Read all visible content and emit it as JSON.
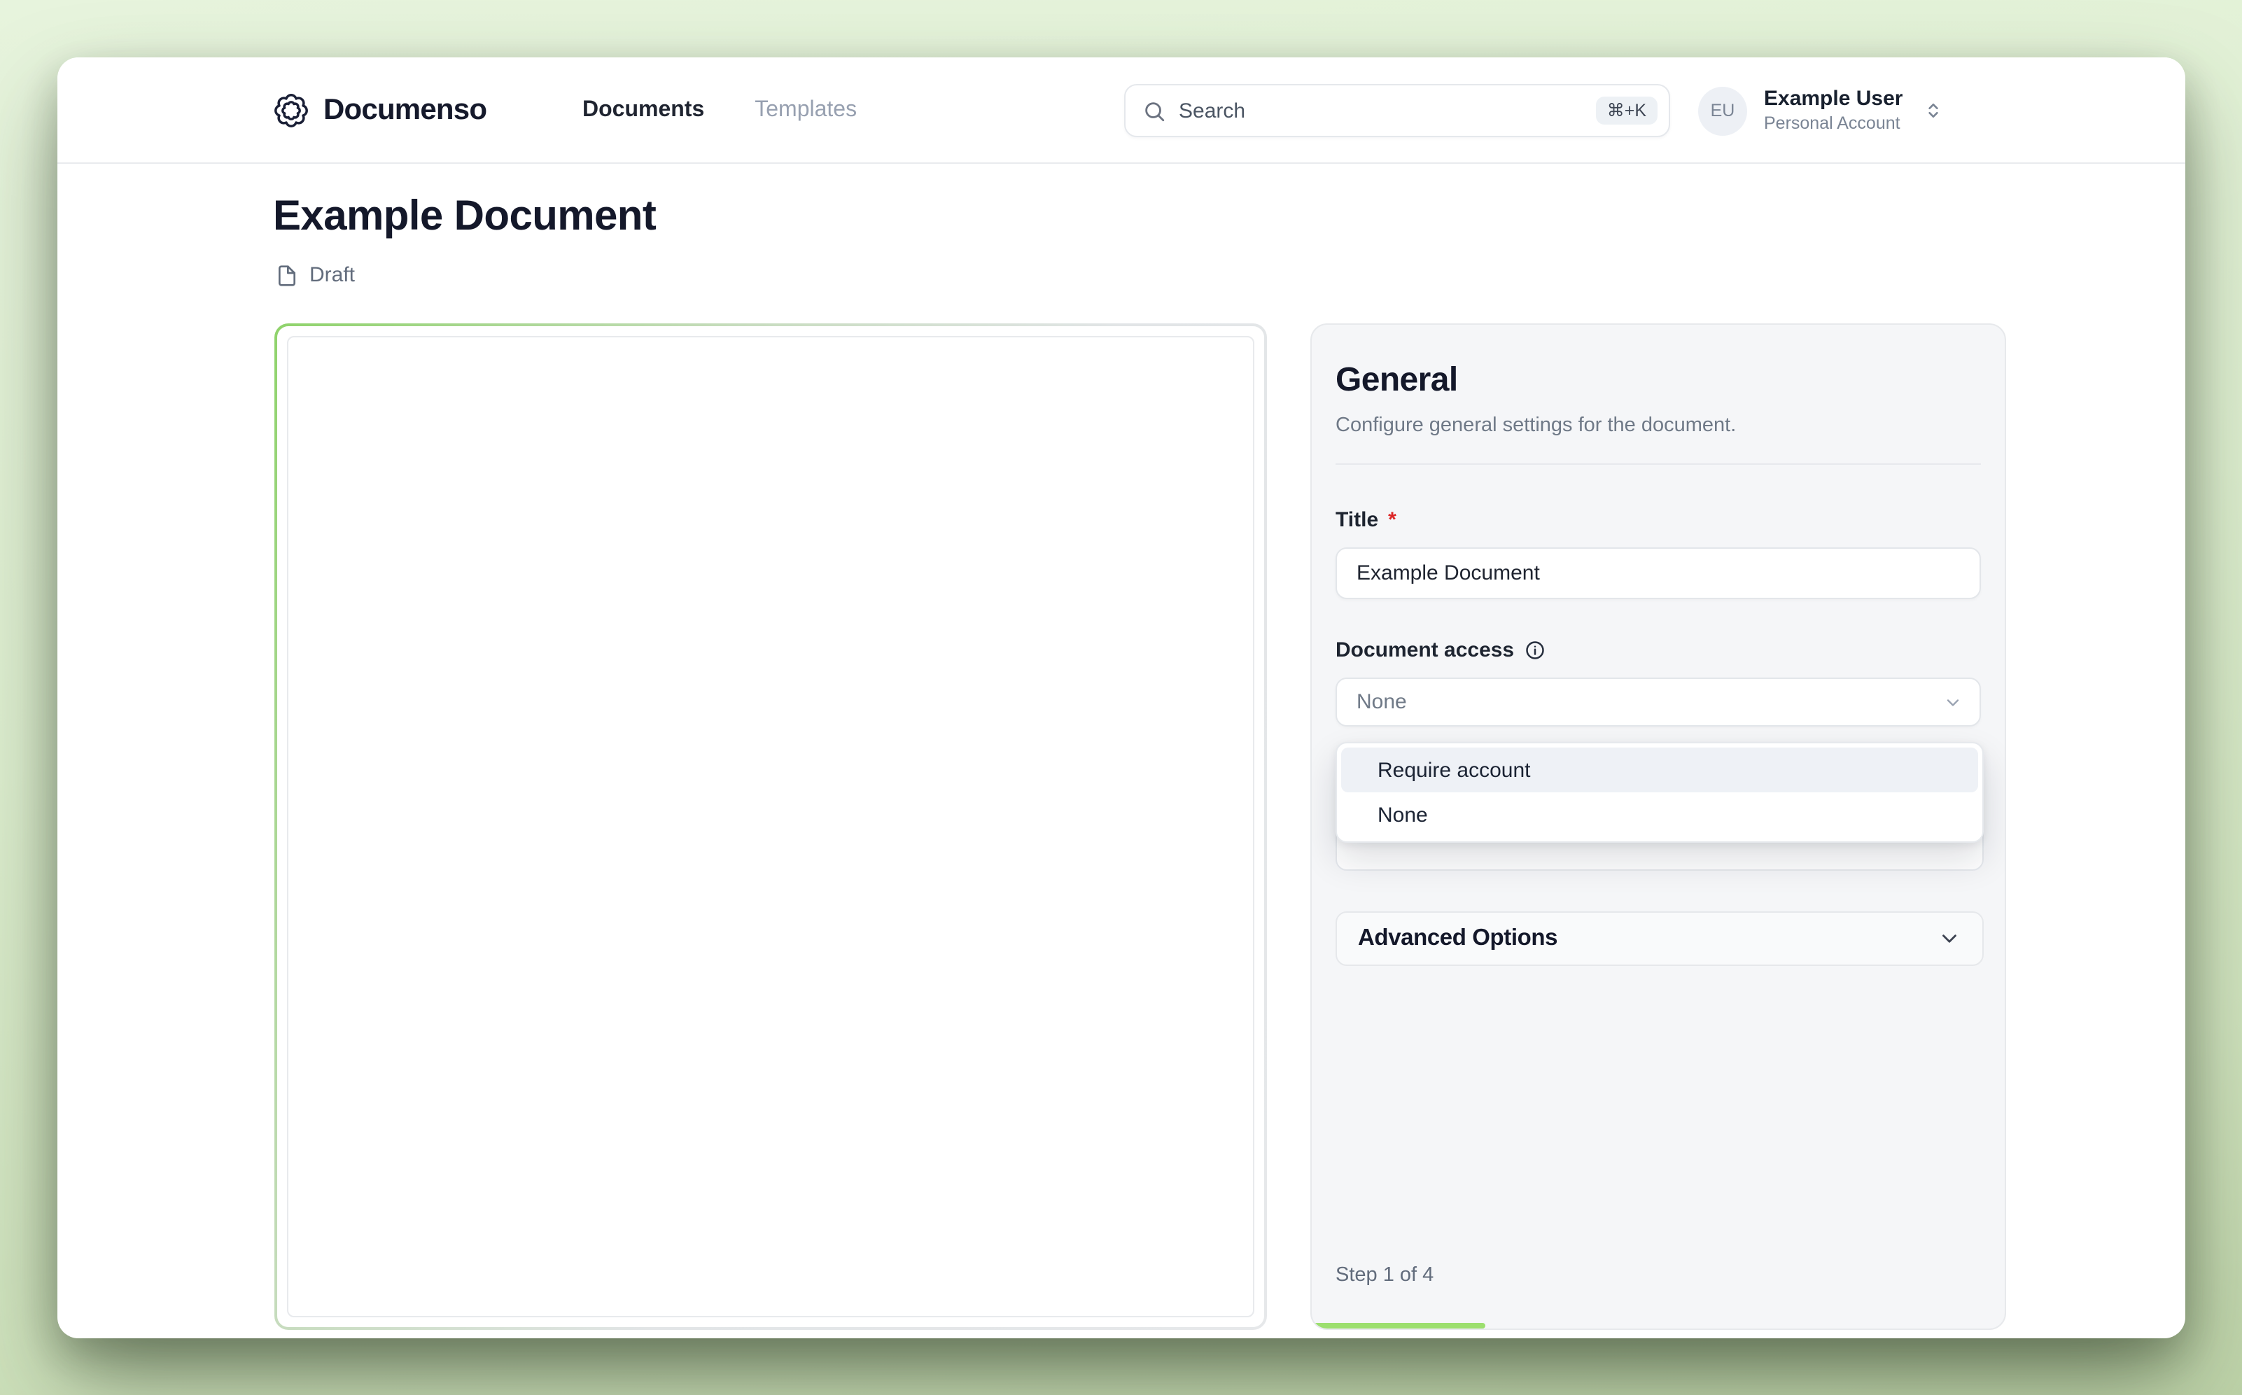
{
  "app": {
    "brand": "Documenso"
  },
  "header": {
    "nav": [
      {
        "label": "Documents"
      },
      {
        "label": "Templates"
      }
    ],
    "search": {
      "placeholder": "Search",
      "shortcut": "⌘+K"
    },
    "user": {
      "initials": "EU",
      "name": "Example User",
      "account_type": "Personal Account"
    }
  },
  "document": {
    "title": "Example Document",
    "status": "Draft"
  },
  "settings_panel": {
    "heading": "General",
    "description": "Configure general settings for the document.",
    "fields": {
      "title": {
        "label": "Title",
        "required_marker": "*",
        "value": "Example Document"
      },
      "document_access": {
        "label": "Document access",
        "value": "None",
        "options": [
          "Require account",
          "None"
        ],
        "highlighted_option": "Require account"
      }
    },
    "advanced_options_label": "Advanced Options",
    "step_text": "Step 1 of 4",
    "progress_percent": 25
  },
  "colors": {
    "accent_green": "#9cdf6e",
    "background_green": "#ddeecf",
    "option_highlight": "#eef1f6",
    "required_red": "#dc2626"
  }
}
